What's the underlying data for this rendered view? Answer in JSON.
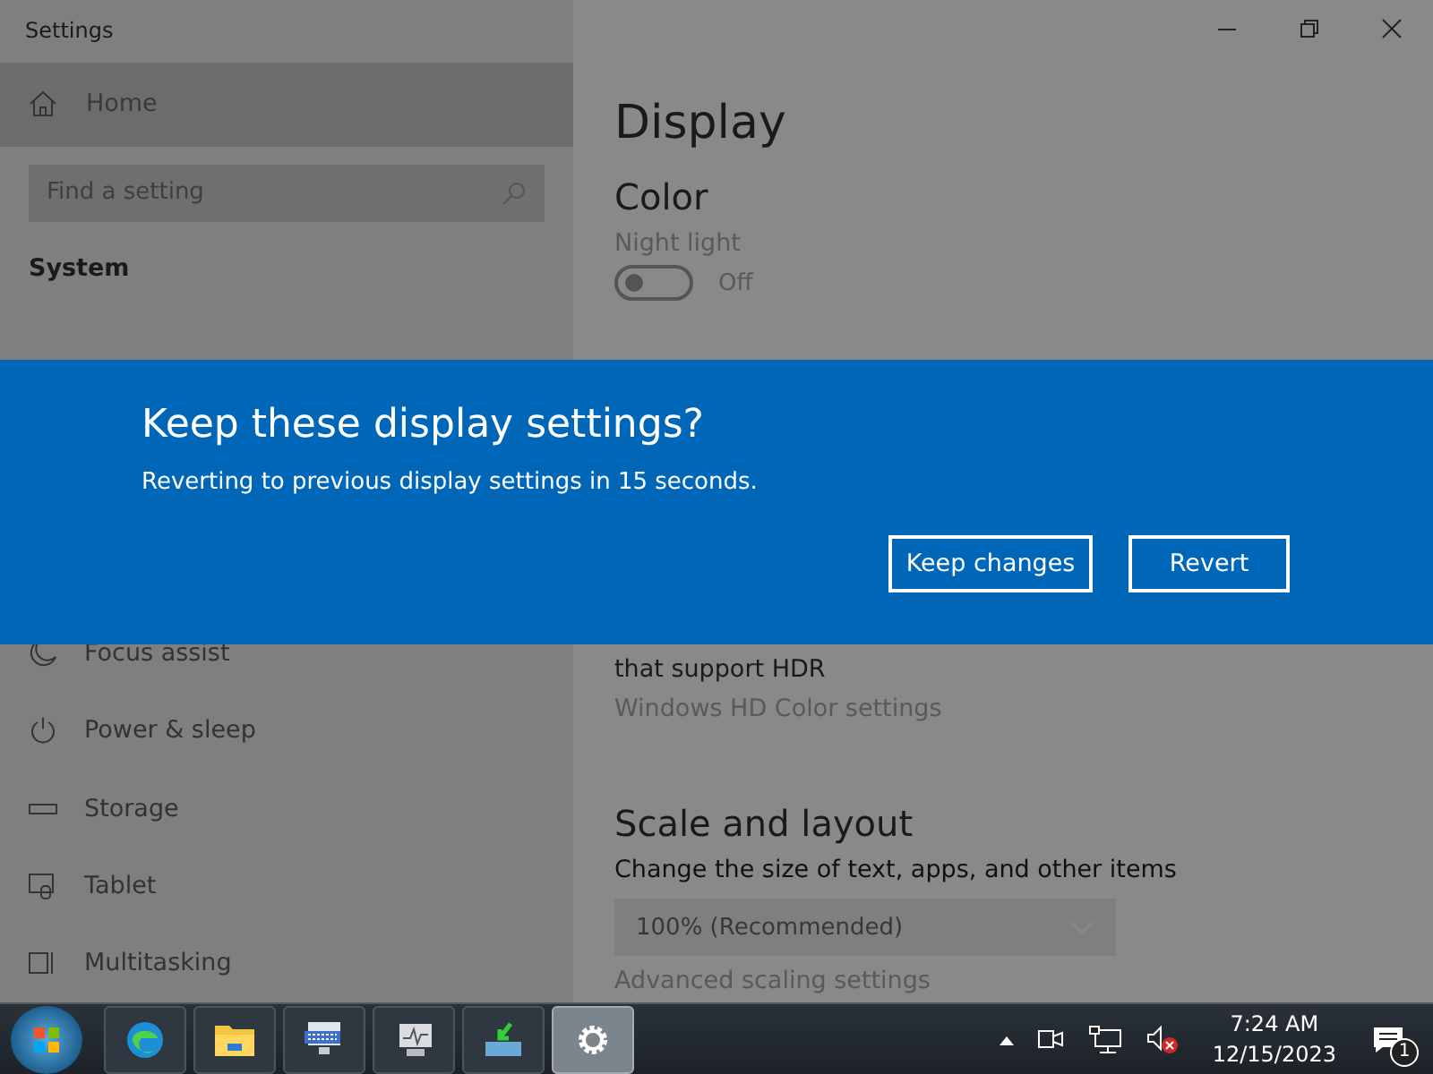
{
  "window": {
    "title": "Settings"
  },
  "sidebar": {
    "home": "Home",
    "search": {
      "placeholder": "Find a setting"
    },
    "section": "System",
    "items": [
      {
        "kind": "moon",
        "label": "Focus assist"
      },
      {
        "kind": "power",
        "label": "Power & sleep"
      },
      {
        "kind": "storage",
        "label": "Storage"
      },
      {
        "kind": "tablet",
        "label": "Tablet"
      },
      {
        "kind": "multitask",
        "label": "Multitasking"
      }
    ]
  },
  "content": {
    "title": "Display",
    "color_heading": "Color",
    "night_light": {
      "label": "Night light",
      "on": false,
      "state": "Off"
    },
    "hdr_text": "that support HDR",
    "hdr_link": "Windows HD Color settings",
    "scale_heading": "Scale and layout",
    "scale_label": "Change the size of text, apps, and other items",
    "scale_value": "100% (Recommended)",
    "advanced_link": "Advanced scaling settings"
  },
  "dialog": {
    "title": "Keep these display settings?",
    "message": "Reverting to previous display settings in 15 seconds.",
    "buttons": [
      "Keep changes",
      "Revert"
    ]
  },
  "taskbar": {
    "apps": [
      {
        "kind": "edge",
        "selected": false
      },
      {
        "kind": "folder",
        "selected": false
      },
      {
        "kind": "keyboard",
        "selected": false
      },
      {
        "kind": "monitor",
        "selected": false
      },
      {
        "kind": "download",
        "selected": false
      },
      {
        "kind": "gear",
        "selected": true
      }
    ],
    "time": "7:24 AM",
    "date": "12/15/2023",
    "notifications": "1"
  }
}
